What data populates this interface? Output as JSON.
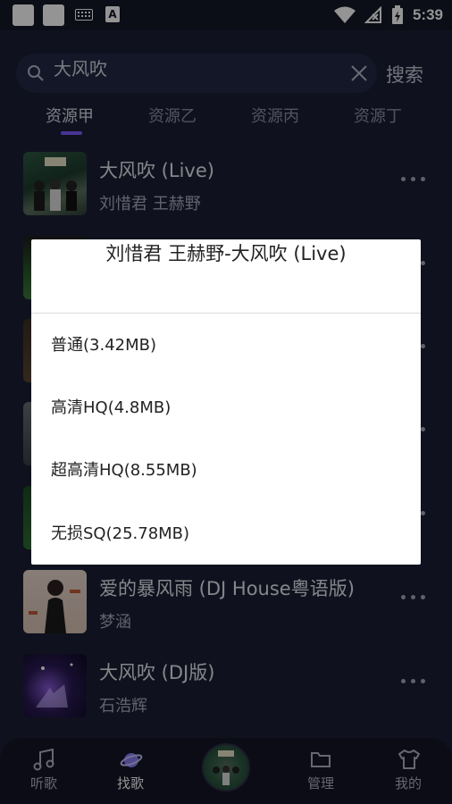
{
  "status_bar": {
    "time": "5:39",
    "notification_icon_letter": "A"
  },
  "search": {
    "query": "大风吹",
    "button_label": "搜索"
  },
  "tabs": [
    {
      "label": "资源甲",
      "active": true
    },
    {
      "label": "资源乙",
      "active": false
    },
    {
      "label": "资源丙",
      "active": false
    },
    {
      "label": "资源丁",
      "active": false
    }
  ],
  "songs": [
    {
      "title": "大风吹 (Live)",
      "artist": "刘惜君  王赫野"
    },
    {
      "title": "",
      "artist": ""
    },
    {
      "title": "",
      "artist": ""
    },
    {
      "title": "",
      "artist": ""
    },
    {
      "title": "",
      "artist": ""
    },
    {
      "title": "爱的暴风雨 (DJ House粤语版)",
      "artist": "梦涵"
    },
    {
      "title": "大风吹 (DJ版)",
      "artist": "石浩辉"
    }
  ],
  "dialog": {
    "title": "刘惜君  王赫野-大风吹 (Live)",
    "options": [
      "普通(3.42MB)",
      "高清HQ(4.8MB)",
      "超高清HQ(8.55MB)",
      "无损SQ(25.78MB)"
    ]
  },
  "bottom_nav": [
    {
      "label": "听歌",
      "icon": "music-note-icon"
    },
    {
      "label": "找歌",
      "icon": "planet-icon",
      "active": true
    },
    {
      "label": "",
      "icon": "now-playing-disc"
    },
    {
      "label": "管理",
      "icon": "folder-icon"
    },
    {
      "label": "我的",
      "icon": "tshirt-icon"
    }
  ],
  "colors": {
    "background": "#1b1f35",
    "accent": "#7d5bff",
    "dialog_bg": "#ffffff"
  }
}
